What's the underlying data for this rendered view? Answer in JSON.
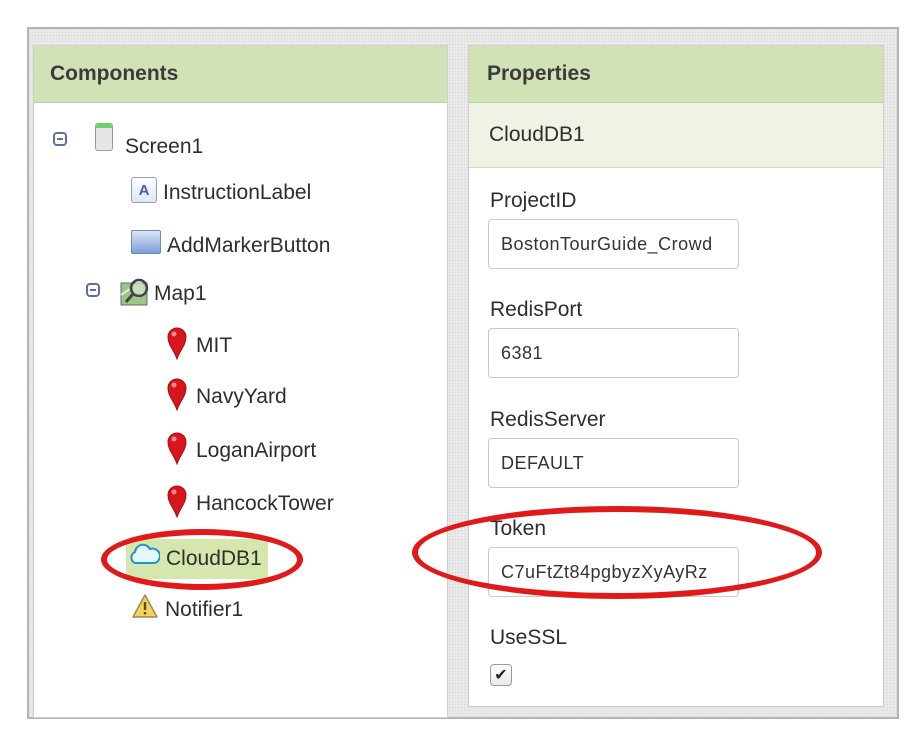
{
  "components": {
    "header": "Components",
    "tree": [
      {
        "label": "Screen1",
        "icon": "screen-icon"
      },
      {
        "label": "InstructionLabel",
        "icon": "label-icon"
      },
      {
        "label": "AddMarkerButton",
        "icon": "button-icon"
      },
      {
        "label": "Map1",
        "icon": "map-icon"
      },
      {
        "label": "MIT",
        "icon": "marker-pin-icon"
      },
      {
        "label": "NavyYard",
        "icon": "marker-pin-icon"
      },
      {
        "label": "LoganAirport",
        "icon": "marker-pin-icon"
      },
      {
        "label": "HancockTower",
        "icon": "marker-pin-icon"
      },
      {
        "label": "CloudDB1",
        "icon": "cloud-icon",
        "selected": true
      },
      {
        "label": "Notifier1",
        "icon": "warning-icon"
      }
    ]
  },
  "properties": {
    "header": "Properties",
    "component_name": "CloudDB1",
    "fields": {
      "project_id": {
        "label": "ProjectID",
        "value": "BostonTourGuide_Crowd"
      },
      "redis_port": {
        "label": "RedisPort",
        "value": "6381"
      },
      "redis_server": {
        "label": "RedisServer",
        "value": "DEFAULT"
      },
      "token": {
        "label": "Token",
        "value": "C7uFtZt84pgbyzXyAyRz"
      },
      "use_ssl": {
        "label": "UseSSL",
        "checked": true,
        "check_glyph": "✔"
      }
    }
  },
  "colors": {
    "header_bg": "#d2e2b7",
    "selected_bg": "#d5e7ad",
    "annotation_red": "#e01a1a",
    "marker_red": "#d8141c"
  }
}
